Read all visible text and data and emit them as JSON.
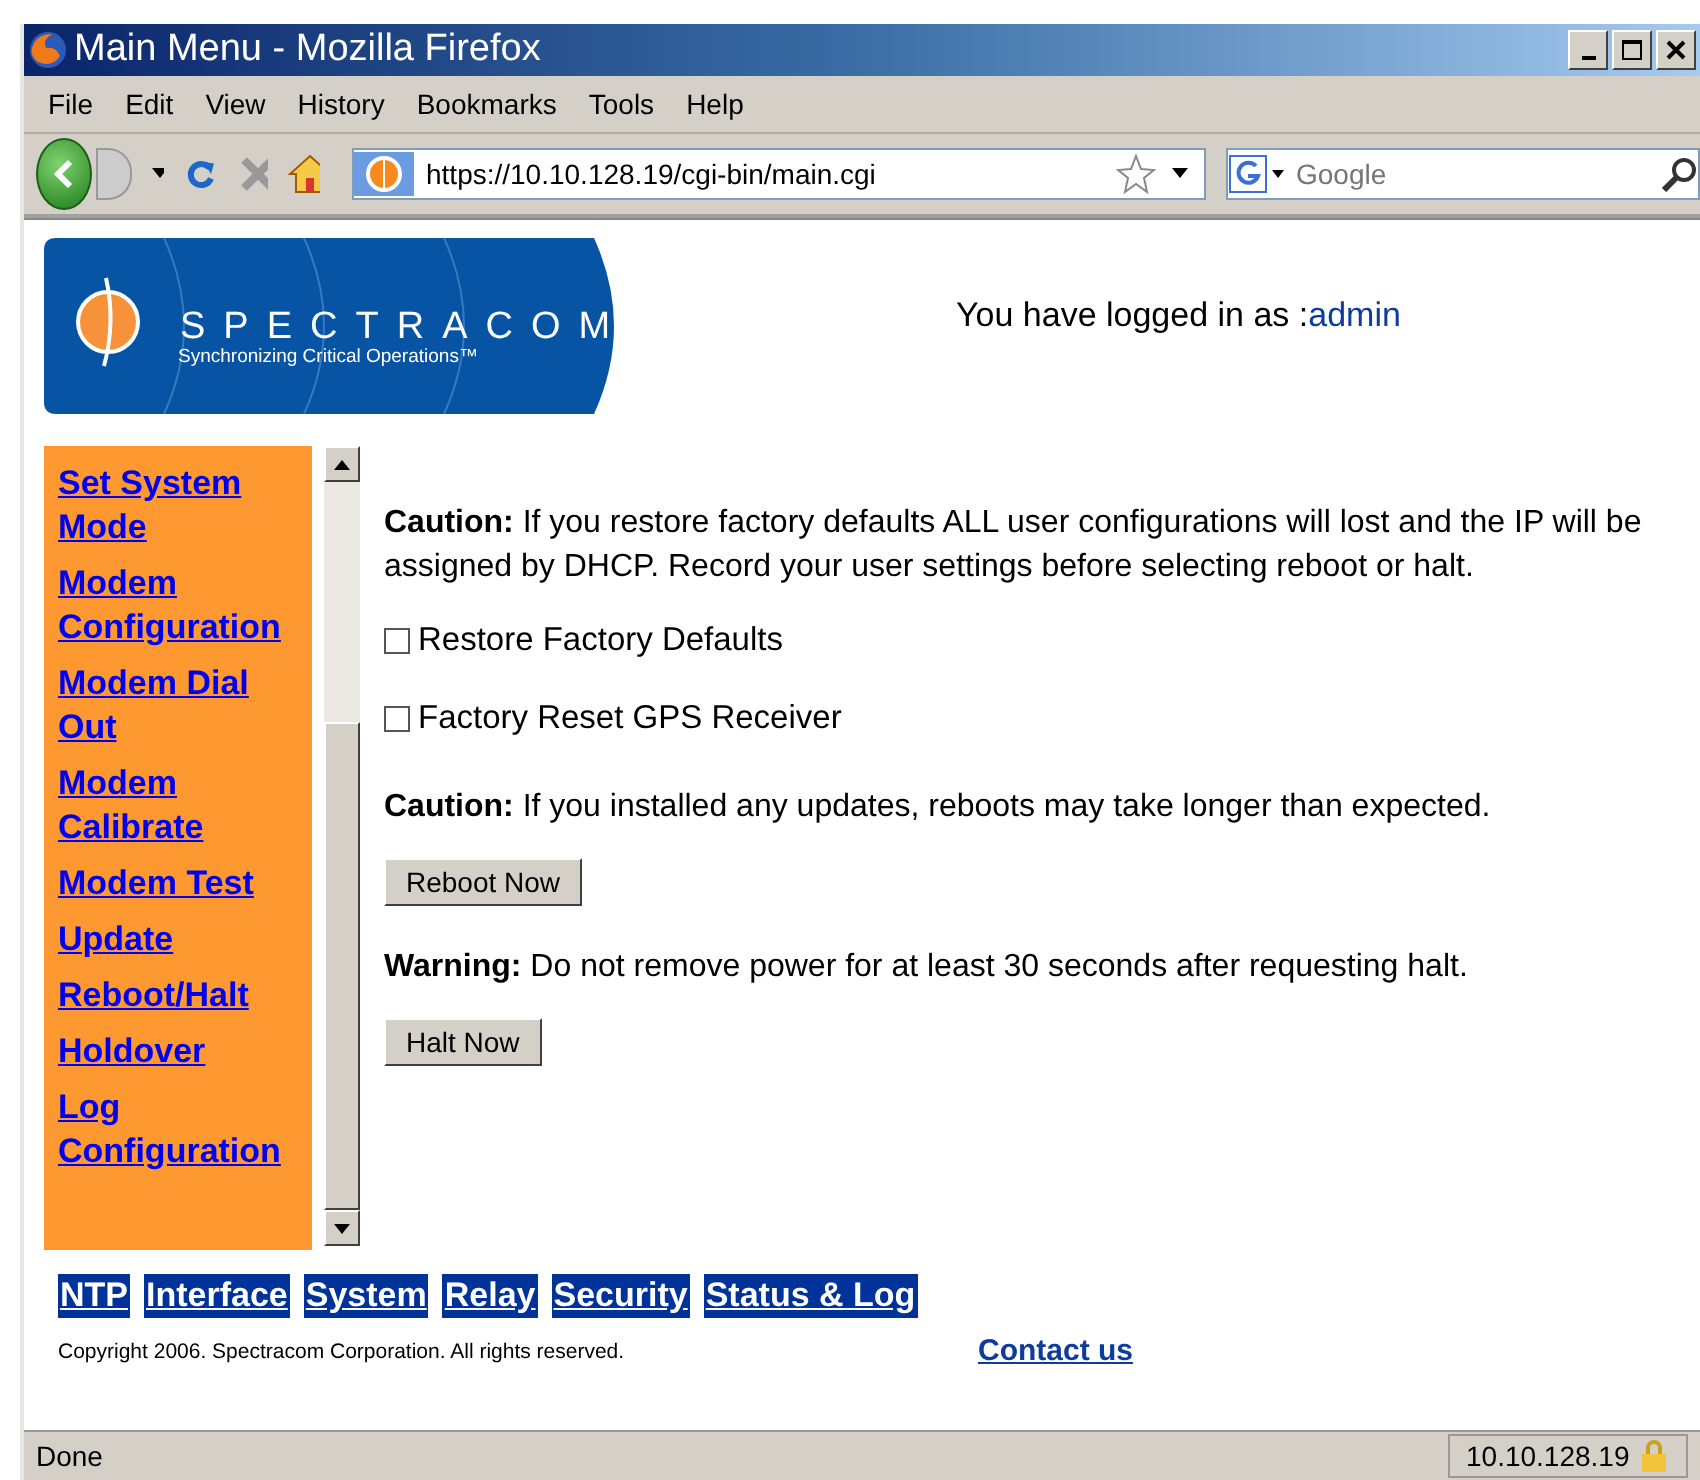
{
  "window": {
    "title": "Main Menu - Mozilla Firefox"
  },
  "menu_bar": [
    "File",
    "Edit",
    "View",
    "History",
    "Bookmarks",
    "Tools",
    "Help"
  ],
  "address_bar": {
    "value": "https://10.10.128.19/cgi-bin/main.cgi"
  },
  "search": {
    "placeholder": "Google"
  },
  "header": {
    "logo_name": "SPECTRACOM",
    "logo_tagline": "Synchronizing Critical Operations™",
    "login_text": "You have logged in as :",
    "user": "admin"
  },
  "sidebar": {
    "items": [
      "Set System Mode",
      "Modem Configuration",
      "Modem Dial Out",
      "Modem Calibrate",
      "Modem Test",
      "Update",
      "Reboot/Halt",
      "Holdover",
      "Log Configuration"
    ]
  },
  "content": [
    {
      "kind": "note",
      "text": "**Caution:** If you restore factory defaults ALL user configurations will lost and the IP will be assigned by DHCP. Record your user settings before selecting reboot or halt."
    },
    {
      "kind": "checkbox",
      "label": "Restore Factory Defaults",
      "checked": false
    },
    {
      "kind": "checkbox",
      "label": "Factory Reset GPS Receiver",
      "checked": false
    },
    {
      "kind": "note",
      "text": "**Caution:** If you installed any updates, reboots may take longer than expected."
    },
    {
      "kind": "button",
      "label": "Reboot Now"
    },
    {
      "kind": "note",
      "text": "**Warning:** Do not remove power for at least 30 seconds after requesting halt."
    },
    {
      "kind": "button",
      "label": "Halt Now"
    }
  ],
  "footer_nav": [
    "NTP",
    "Interface",
    "System",
    "Relay",
    "Security",
    "Status & Log"
  ],
  "copyright": "Copyright 2006. Spectracom Corporation. All rights reserved.",
  "contact_link": "Contact us",
  "status_bar": {
    "text": "Done",
    "host": "10.10.128.19"
  }
}
